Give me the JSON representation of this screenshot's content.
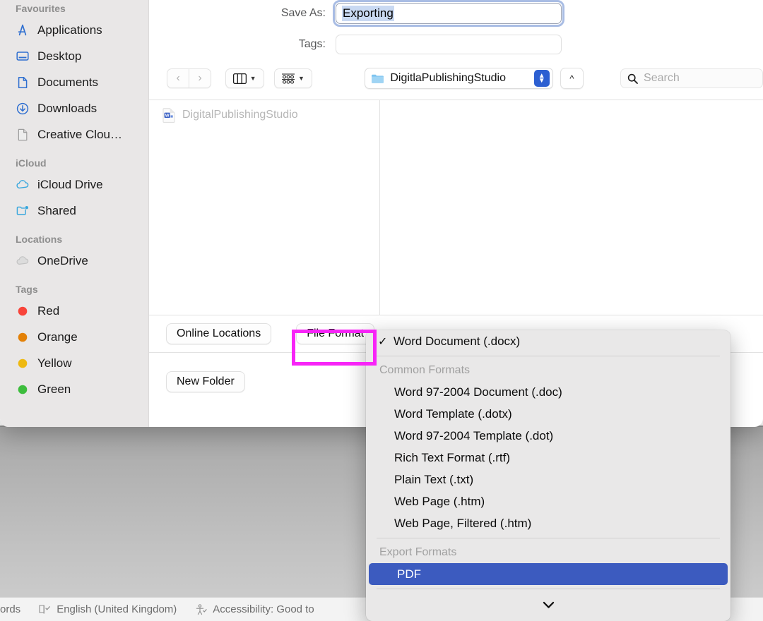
{
  "dialog": {
    "save_as_label": "Save As:",
    "save_as_value": "Exporting",
    "tags_label": "Tags:",
    "tags_value": "",
    "path_name": "DigitlaPublishingStudio",
    "search_placeholder": "Search",
    "file_list": [
      {
        "name": "DigitalPublishingStudio",
        "icon": "word-document-icon"
      }
    ],
    "buttons": {
      "online_locations": "Online Locations",
      "file_format": "File Format",
      "new_folder": "New Folder"
    }
  },
  "sidebar": {
    "sections": [
      {
        "title": "Favourites",
        "items": [
          {
            "label": "Applications",
            "icon": "applications-icon"
          },
          {
            "label": "Desktop",
            "icon": "desktop-icon"
          },
          {
            "label": "Documents",
            "icon": "documents-icon"
          },
          {
            "label": "Downloads",
            "icon": "downloads-icon"
          },
          {
            "label": "Creative Clou…",
            "icon": "file-icon"
          }
        ]
      },
      {
        "title": "iCloud",
        "items": [
          {
            "label": "iCloud Drive",
            "icon": "cloud-icon"
          },
          {
            "label": "Shared",
            "icon": "shared-folder-icon"
          }
        ]
      },
      {
        "title": "Locations",
        "items": [
          {
            "label": "OneDrive",
            "icon": "cloud-grey-icon"
          }
        ]
      },
      {
        "title": "Tags",
        "items": [
          {
            "label": "Red",
            "icon": "tag-dot-icon",
            "color": "#f8443a"
          },
          {
            "label": "Orange",
            "icon": "tag-dot-icon",
            "color": "#e38107"
          },
          {
            "label": "Yellow",
            "icon": "tag-dot-icon",
            "color": "#eeb911"
          },
          {
            "label": "Green",
            "icon": "tag-dot-icon",
            "color": "#3dbd3d"
          }
        ]
      }
    ]
  },
  "menu": {
    "current": {
      "label": "Word Document (.docx)",
      "checked": true
    },
    "group_common_label": "Common Formats",
    "common_formats": [
      "Word 97-2004 Document (.doc)",
      "Word Template (.dotx)",
      "Word 97-2004 Template (.dot)",
      "Rich Text Format (.rtf)",
      "Plain Text (.txt)",
      "Web Page (.htm)",
      "Web Page, Filtered (.htm)"
    ],
    "group_export_label": "Export Formats",
    "export_formats": [
      {
        "label": "PDF",
        "selected": true
      }
    ],
    "scroll_hint": "⌄",
    "selection_color": "#3c5bbf"
  },
  "statusbar": {
    "words": "ords",
    "language": "English (United Kingdom)",
    "accessibility": "Accessibility: Good to"
  },
  "annotation": {
    "target": "File Format",
    "color": "#f724f7"
  }
}
